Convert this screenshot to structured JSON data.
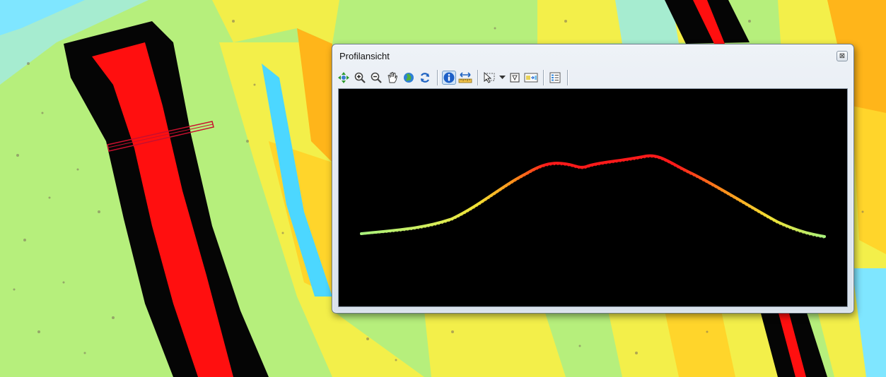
{
  "window": {
    "title": "Profilansicht",
    "close_glyph": "⊠"
  },
  "toolbar": {
    "tools": [
      {
        "name": "pan-icon",
        "active": false
      },
      {
        "name": "zoom-in-icon",
        "active": false
      },
      {
        "name": "zoom-out-icon",
        "active": false
      },
      {
        "name": "hand-icon",
        "active": false
      },
      {
        "name": "globe-icon",
        "active": false
      },
      {
        "name": "refresh-icon",
        "active": false
      },
      {
        "name": "info-icon",
        "active": true
      },
      {
        "name": "measure-icon",
        "active": false
      },
      {
        "name": "select-arrow-icon",
        "active": false
      },
      {
        "name": "dropdown-arrow-icon",
        "active": false
      },
      {
        "name": "polygon-icon",
        "active": false
      },
      {
        "name": "export-icon",
        "active": false
      },
      {
        "name": "legend-icon",
        "active": false
      }
    ]
  },
  "colors": {
    "low": "#a8f07c",
    "mid": "#f2e234",
    "high": "#ff8c1a",
    "peak": "#ff0000",
    "plot_background": "#000000"
  }
}
